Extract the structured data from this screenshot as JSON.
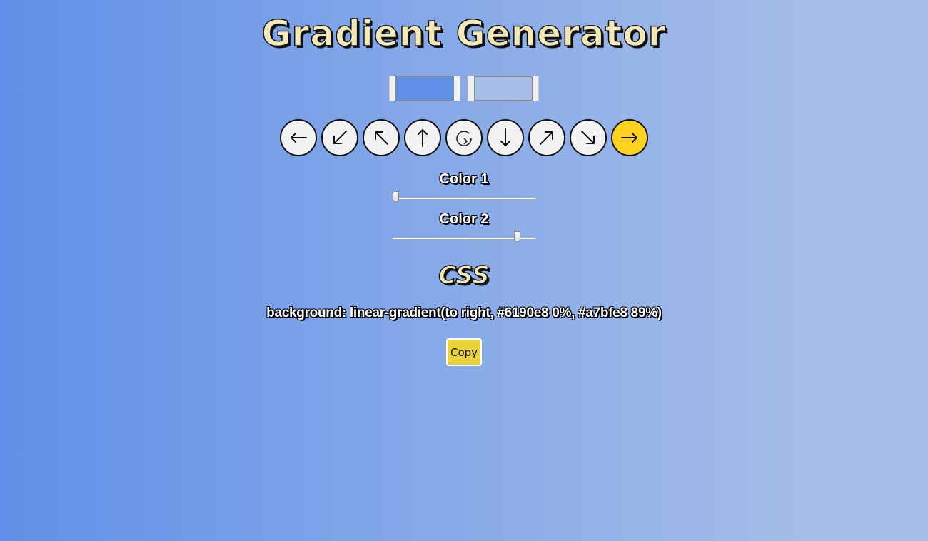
{
  "app": {
    "title": "Gradient Generator",
    "gradient": {
      "color1": "#6190e8",
      "color2": "#a7bfe8",
      "stop1_percent": 0,
      "stop2_percent": 89,
      "direction": "to right"
    }
  },
  "pickers": {
    "color1_value": "#6190e8",
    "color2_value": "#a7bfe8"
  },
  "directions": [
    {
      "icon": "arrow-left-icon",
      "glyph": "←",
      "value": "to left",
      "active": false
    },
    {
      "icon": "arrow-down-left-icon",
      "glyph": "↙",
      "value": "to bottom left",
      "active": false
    },
    {
      "icon": "arrow-up-left-icon",
      "glyph": "↖",
      "value": "to top left",
      "active": false
    },
    {
      "icon": "arrow-up-icon",
      "glyph": "↑",
      "value": "to top",
      "active": false
    },
    {
      "icon": "radial-icon",
      "glyph": "↻",
      "value": "radial",
      "active": false
    },
    {
      "icon": "arrow-down-icon",
      "glyph": "↓",
      "value": "to bottom",
      "active": false
    },
    {
      "icon": "arrow-up-right-icon",
      "glyph": "↗",
      "value": "to top right",
      "active": false
    },
    {
      "icon": "arrow-down-right-icon",
      "glyph": "↘",
      "value": "to bottom right",
      "active": false
    },
    {
      "icon": "arrow-right-icon",
      "glyph": "→",
      "value": "to right",
      "active": true
    }
  ],
  "sliders": {
    "color1_label": "Color 1",
    "color1_value": 0,
    "color2_label": "Color 2",
    "color2_value": 89
  },
  "css_section": {
    "heading": "CSS",
    "output": "background: linear-gradient(to right, #6190e8 0%, #a7bfe8 89%)"
  },
  "copy_button": {
    "label": "Copy"
  },
  "colors": {
    "active_direction": "#ffd21f",
    "copy_button": "#e9d33a",
    "title_fill": "#f2e8b8"
  }
}
